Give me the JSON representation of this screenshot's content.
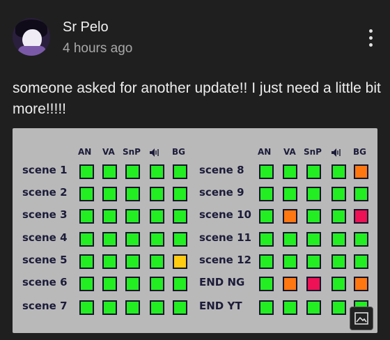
{
  "post": {
    "author": "Sr Pelo",
    "time": "4 hours ago",
    "text": "someone asked for another update!! I just need a little bit more!!!!!"
  },
  "grid": {
    "headers": [
      "AN",
      "VA",
      "SnP",
      "speaker-icon",
      "BG"
    ],
    "colors": {
      "G": "#22ee22",
      "O": "#ff7711",
      "M": "#ee1155",
      "Y": "#ffcc11"
    },
    "left": [
      {
        "label": "scene 1",
        "cells": "GGGGG"
      },
      {
        "label": "scene 2",
        "cells": "GGGGG"
      },
      {
        "label": "scene 3",
        "cells": "GGGGG"
      },
      {
        "label": "scene 4",
        "cells": "GGGGG"
      },
      {
        "label": "scene 5",
        "cells": "GGGGY"
      },
      {
        "label": "scene 6",
        "cells": "GGGGG"
      },
      {
        "label": "scene 7",
        "cells": "GGGGG"
      }
    ],
    "right": [
      {
        "label": "scene 8",
        "cells": "GGGGO"
      },
      {
        "label": "scene 9",
        "cells": "GGGGG"
      },
      {
        "label": "scene 10",
        "cells": "GOGGM"
      },
      {
        "label": "scene 11",
        "cells": "GGGGG"
      },
      {
        "label": "scene 12",
        "cells": "GGGGG"
      },
      {
        "label": "END NG",
        "cells": "GOMGO"
      },
      {
        "label": "END YT",
        "cells": "GGGGG"
      }
    ]
  }
}
